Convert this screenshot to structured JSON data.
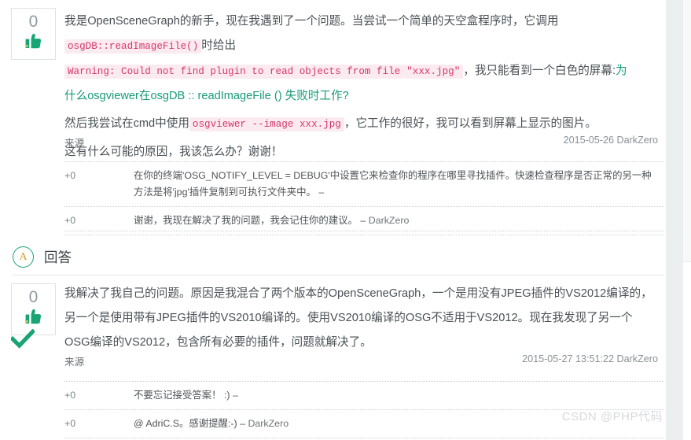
{
  "question": {
    "vote_count": "0",
    "thumb_icon": "thumbs-up-icon",
    "paragraph1_part1": "我是OpenSceneGraph的新手，现在我遇到了一个问题。当尝试一个简单的天空盒程序时，它调用",
    "code1": "osgDB::readImageFile()",
    "paragraph1_part2": "时给出",
    "code2": "Warning: Could not find plugin to read objects from file",
    "code3": "\"xxx.jpg\"",
    "paragraph1_part3": "，我只能看到一个白色的屏幕:",
    "link_text": "为什么osgviewer在osgDB :: readImageFile () 失败时工作?",
    "paragraph2_part1": "然后我尝试在cmd中使用",
    "code4": "osgviewer --image xxx.jpg",
    "paragraph2_part2": "，它工作的很好，我可以看到屏幕上显示的图片。",
    "paragraph3": "这有什么可能的原因，我该怎么办？谢谢！",
    "source_label": "来源",
    "meta": "2015-05-26 DarkZero",
    "comments": [
      {
        "score": "+0",
        "text": "在你的终端'OSG_NOTIFY_LEVEL = DEBUG'中设置它来检查你的程序在哪里寻找插件。快速检查程序是否正常的另一种方法是将'jpg'插件复制到可执行文件夹中。 –",
        "user": ""
      },
      {
        "score": "+0",
        "text": "谢谢，我现在解决了我的问题，我会记住你的建议。 – ",
        "user": "DarkZero"
      }
    ]
  },
  "answers_header": {
    "badge": "A",
    "title": "回答"
  },
  "answer": {
    "vote_count": "0",
    "thumb_icon": "thumbs-up-icon",
    "accepted_icon": "check-mark-icon",
    "body": "我解决了我自己的问题。原因是我混合了两个版本的OpenSceneGraph，一个是用没有JPEG插件的VS2012编译的，另一个是使用带有JPEG插件的VS2010编译的。使用VS2010编译的OSG不适用于VS2012。现在我发现了另一个OSG编译的VS2012，包含所有必要的插件，问题就解决了。",
    "source_label": "来源",
    "meta": "2015-05-27 13:51:22 DarkZero",
    "comments": [
      {
        "score": "+0",
        "text": "不要忘记接受答案！ :) –",
        "user": ""
      },
      {
        "score": "+0",
        "text": "@ AdriC.S。感谢提醒:-) – ",
        "user": "DarkZero"
      }
    ]
  },
  "watermark": "CSDN @PHP代码",
  "colors": {
    "link": "#179b7a",
    "code_text": "#d4376a",
    "code_bg": "#fbebf0",
    "accent_green": "#1aa179",
    "text": "#4a5055"
  }
}
